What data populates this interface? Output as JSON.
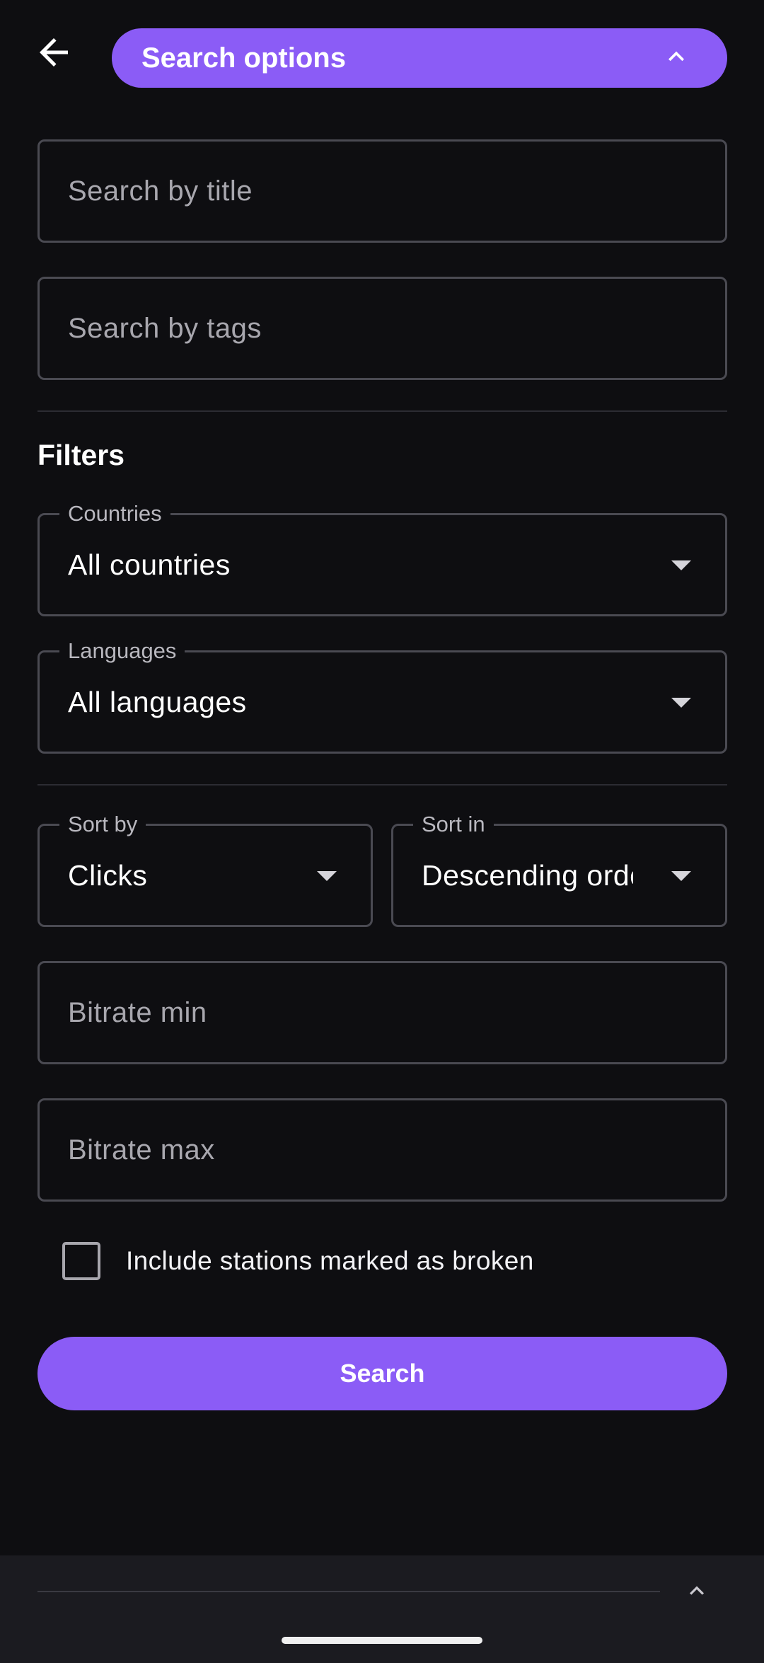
{
  "header": {
    "back_icon": "arrow-left-icon",
    "title": "Search options",
    "collapse_icon": "chevron-up-icon",
    "accent_color": "#8b5cf6"
  },
  "search": {
    "title_placeholder": "Search by title",
    "tags_placeholder": "Search by tags"
  },
  "filters": {
    "heading": "Filters",
    "countries": {
      "label": "Countries",
      "value": "All countries"
    },
    "languages": {
      "label": "Languages",
      "value": "All languages"
    },
    "sort_by": {
      "label": "Sort by",
      "value": "Clicks"
    },
    "sort_in": {
      "label": "Sort in",
      "value": "Descending order"
    },
    "bitrate_min_placeholder": "Bitrate min",
    "bitrate_max_placeholder": "Bitrate max",
    "include_broken": {
      "label": "Include stations marked as broken",
      "checked": false
    }
  },
  "actions": {
    "search_label": "Search"
  },
  "bottom_bar": {
    "expand_icon": "chevron-up-icon"
  }
}
